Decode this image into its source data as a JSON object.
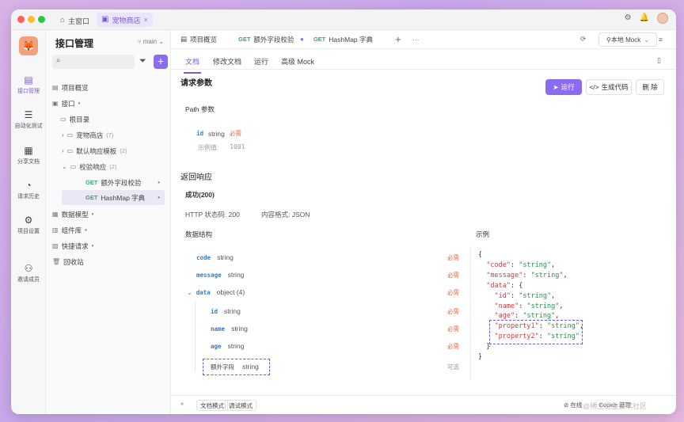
{
  "window": {
    "tabs": [
      {
        "label": "主窗口",
        "icon": "home-icon"
      },
      {
        "label": "宠物商店",
        "icon": "project-icon"
      }
    ]
  },
  "rail": {
    "items": [
      {
        "label": "接口管理",
        "icon": "api-icon"
      },
      {
        "label": "自动化测试",
        "icon": "stack-icon"
      },
      {
        "label": "分享文档",
        "icon": "share-icon"
      },
      {
        "label": "请求历史",
        "icon": "clock-icon"
      },
      {
        "label": "项目设置",
        "icon": "settings-icon"
      },
      {
        "label": "邀请成员",
        "icon": "invite-icon"
      }
    ]
  },
  "sidebar": {
    "title": "接口管理",
    "branch": "main",
    "tree": [
      {
        "label": "项目概览"
      },
      {
        "label": "接口"
      },
      {
        "label": "根目录"
      },
      {
        "label": "宠物商店",
        "count": "(7)"
      },
      {
        "label": "默认响应模板",
        "count": "(2)"
      },
      {
        "label": "校验响应",
        "count": "(2)"
      },
      {
        "method": "GET",
        "label": "额外字段校验"
      },
      {
        "method": "GET",
        "label": "HashMap 字典"
      },
      {
        "label": "数据模型"
      },
      {
        "label": "组件库"
      },
      {
        "label": "快捷请求"
      },
      {
        "label": "回收站"
      }
    ]
  },
  "tabs": {
    "overview": "项目概览",
    "t1_method": "GET",
    "t1_label": "额外字段校验",
    "t2_method": "GET",
    "t2_label": "HashMap 字典",
    "env": "本地 Mock"
  },
  "subtabs": [
    "文档",
    "修改文档",
    "运行",
    "高级 Mock"
  ],
  "request": {
    "title": "请求参数",
    "path_title": "Path 参数",
    "param_name": "id",
    "param_type": "string",
    "param_req": "必需",
    "example_label": "示例值:",
    "example_value": "1001"
  },
  "actions": {
    "run": "运行",
    "gen": "生成代码",
    "del": "删 除"
  },
  "response": {
    "title": "返回响应",
    "status": "成功(200)",
    "http": "HTTP 状态码: 200",
    "fmt": "内容格式: JSON",
    "schema_title": "数据结构",
    "example_title": "示例",
    "fields": [
      {
        "name": "code",
        "type": "string",
        "flag": "必需"
      },
      {
        "name": "message",
        "type": "string",
        "flag": "必需"
      },
      {
        "name": "data",
        "type": "object (4)",
        "flag": "必需"
      },
      {
        "name": "id",
        "type": "string",
        "flag": "必需"
      },
      {
        "name": "name",
        "type": "string",
        "flag": "必需"
      },
      {
        "name": "age",
        "type": "string",
        "flag": "必需"
      },
      {
        "name": "额外字段",
        "type": "string",
        "flag": "可选"
      }
    ]
  },
  "status": {
    "doc": "文档模式",
    "debug": "调试模式",
    "online": "在线",
    "cookie": "Cookie 管理",
    "watermark": "@稀土掘金技术社区"
  }
}
